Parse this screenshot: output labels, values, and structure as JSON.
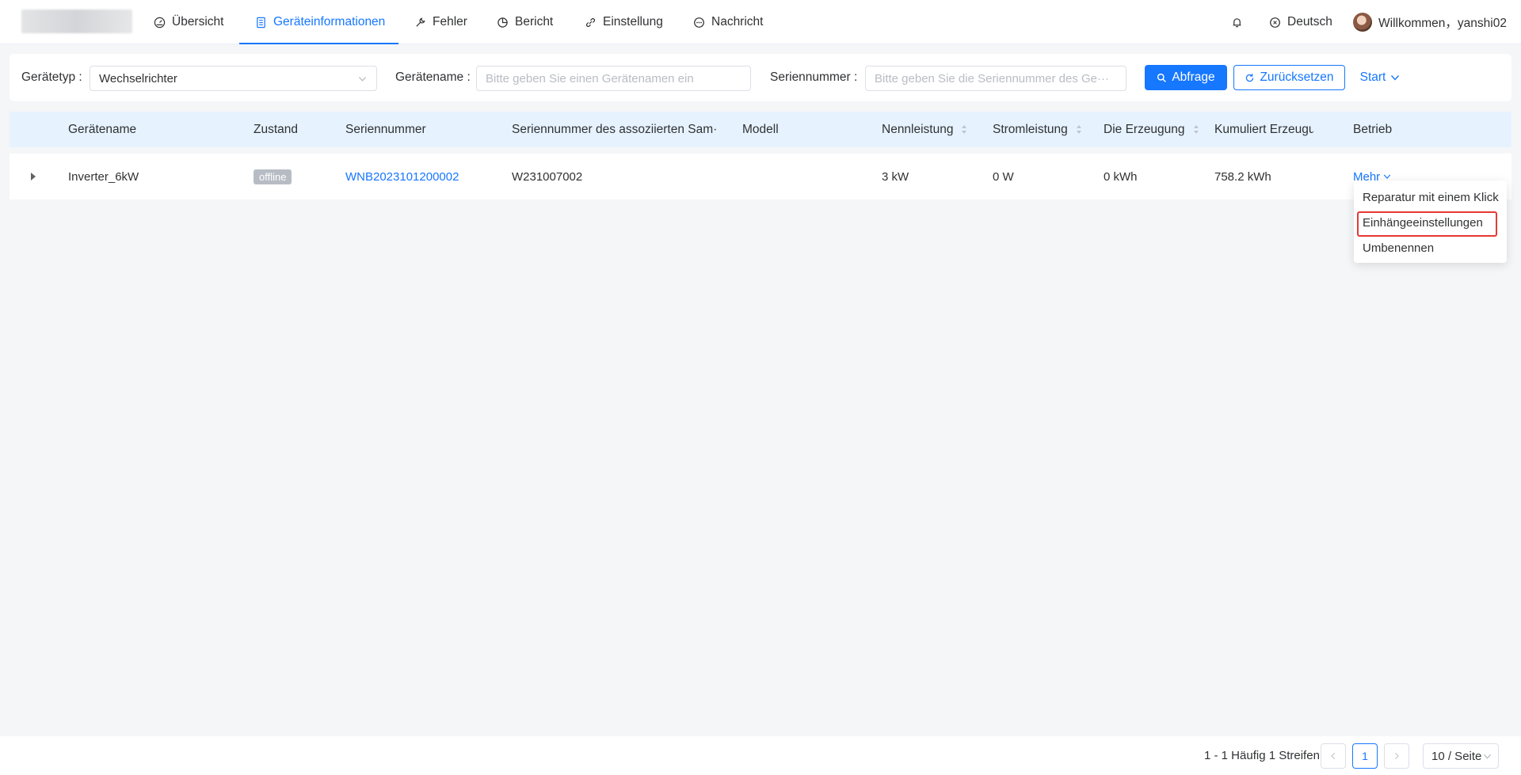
{
  "nav": {
    "items": [
      {
        "label": "Übersicht",
        "icon": "dashboard-icon"
      },
      {
        "label": "Geräteinformationen",
        "icon": "document-icon"
      },
      {
        "label": "Fehler",
        "icon": "wrench-icon"
      },
      {
        "label": "Bericht",
        "icon": "pie-chart-icon"
      },
      {
        "label": "Einstellung",
        "icon": "link-icon"
      },
      {
        "label": "Nachricht",
        "icon": "message-icon"
      }
    ],
    "active_index": 1,
    "language": "Deutsch",
    "welcome": "Willkommen，yanshi02"
  },
  "filters": {
    "device_type_label": "Gerätetyp :",
    "device_type_value": "Wechselrichter",
    "device_name_label": "Gerätename :",
    "device_name_placeholder": "Bitte geben Sie einen Gerätenamen ein",
    "serial_label": "Seriennummer :",
    "serial_placeholder": "Bitte geben Sie die Seriennummer des Ge···",
    "query_button": "Abfrage",
    "reset_button": "Zurücksetzen",
    "start_link": "Start"
  },
  "table": {
    "headers": {
      "name": "Gerätename",
      "state": "Zustand",
      "serial": "Seriennummer",
      "assoc_serial": "Seriennummer des assoziierten Sam···",
      "model": "Modell",
      "rated_power": "Nennleistung",
      "current_power": "Stromleistung",
      "generation": "Die Erzeugung",
      "cumulative": "Kumuliert Erzeugu",
      "operation": "Betrieb"
    },
    "rows": [
      {
        "name": "Inverter_6kW",
        "state": "offline",
        "serial": "WNB2023101200002",
        "assoc_serial": "W231007002",
        "model": "",
        "rated_power": "3 kW",
        "current_power": "0 W",
        "generation": "0 kWh",
        "cumulative": "758.2 kWh",
        "operation": "Mehr"
      }
    ]
  },
  "dropdown": {
    "items": [
      "Reparatur mit einem Klick",
      "Einhängeeinstellungen",
      "Umbenennen"
    ],
    "highlighted_index": 1
  },
  "pagination": {
    "total": "1 - 1 Häufig 1 Streifen",
    "current_page": "1",
    "page_size": "10 / Seite"
  },
  "colors": {
    "accent": "#1677ff",
    "header_bg": "#e6f3ff",
    "highlight_border": "#e53935"
  }
}
